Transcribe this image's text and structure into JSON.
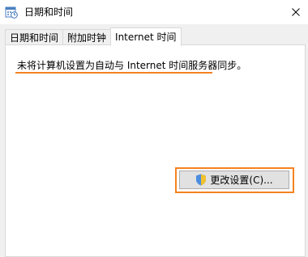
{
  "window": {
    "title": "日期和时间",
    "close_glyph": "✕"
  },
  "tabs": [
    {
      "label": "日期和时间"
    },
    {
      "label": "附加时钟"
    },
    {
      "label": "Internet 时间",
      "active": true
    }
  ],
  "panel": {
    "message": "未将计算机设置为自动与 Internet 时间服务器同步。",
    "change_button_label": "更改设置(C)..."
  },
  "colors": {
    "highlight": "#f5821f",
    "button_bg": "#e1e1e1"
  },
  "icons": {
    "title": "clock-calendar-icon",
    "close": "close-icon",
    "button": "uac-shield-icon"
  }
}
